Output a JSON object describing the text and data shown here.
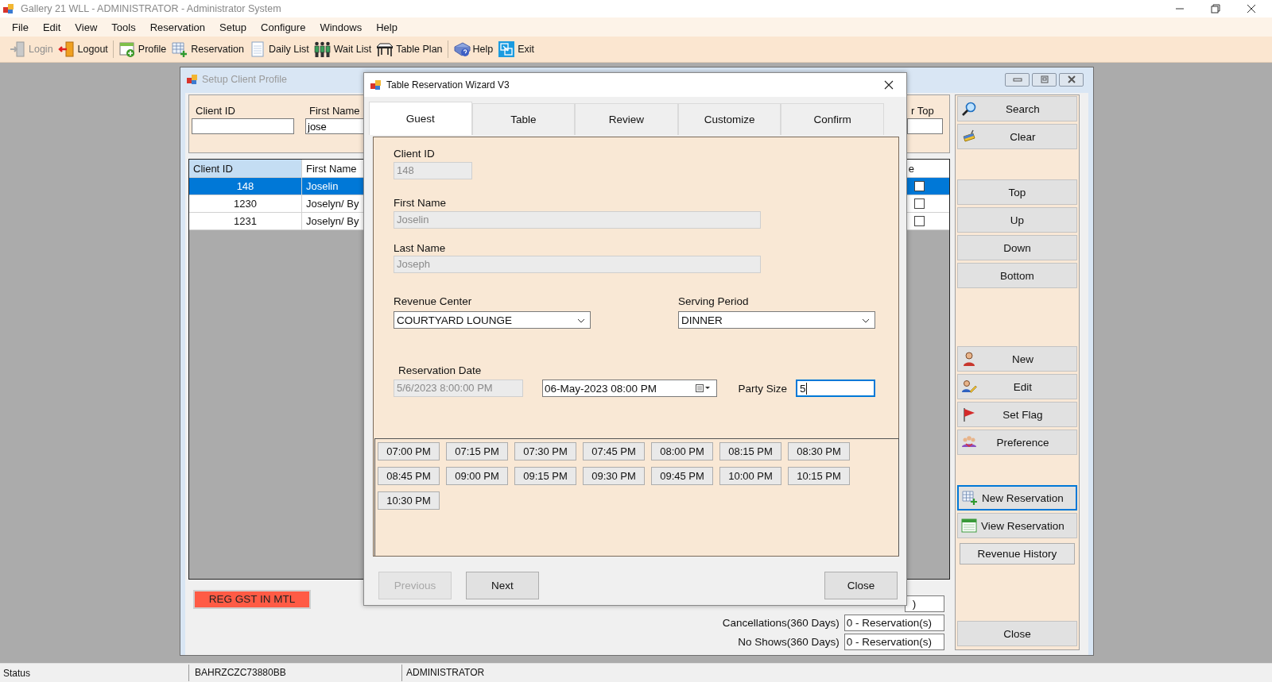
{
  "window": {
    "title": "Gallery 21 WLL  -  ADMINISTRATOR - Administrator System"
  },
  "menu": [
    "File",
    "Edit",
    "View",
    "Tools",
    "Reservation",
    "Setup",
    "Configure",
    "Windows",
    "Help"
  ],
  "toolbar": [
    {
      "items": [
        {
          "label": "Login",
          "disabled": true
        },
        {
          "label": "Logout",
          "disabled": false
        }
      ]
    },
    {
      "items": [
        {
          "label": "Profile",
          "disabled": false
        },
        {
          "label": "Reservation",
          "disabled": false
        },
        {
          "label": "Daily List",
          "disabled": false
        },
        {
          "label": "Wait List",
          "disabled": false
        },
        {
          "label": "Table Plan",
          "disabled": false
        }
      ]
    },
    {
      "items": [
        {
          "label": "Help",
          "disabled": false
        },
        {
          "label": "Exit",
          "disabled": false
        }
      ]
    }
  ],
  "client_profile": {
    "title": "Setup Client Profile",
    "search_fields": [
      {
        "label": "Client ID"
      },
      {
        "label": "First Name",
        "value": "jose"
      },
      {
        "label": "r Top"
      }
    ],
    "table": {
      "columns": [
        "Client ID",
        "First Name",
        "e"
      ],
      "rows": [
        {
          "client_id": "148",
          "first_name": "Joselin",
          "checked": false,
          "selected": true
        },
        {
          "client_id": "1230",
          "first_name": "Joselyn/ By",
          "checked": false,
          "selected": false
        },
        {
          "client_id": "1231",
          "first_name": "Joselyn/ By",
          "checked": false,
          "selected": false
        }
      ]
    },
    "flag": "REG GST IN MTL",
    "stats": [
      {
        "value": ")"
      },
      {
        "label": "Cancellations(360 Days)",
        "value": "0 - Reservation(s)"
      },
      {
        "label": "No Shows(360 Days)",
        "value": "0 - Reservation(s)"
      }
    ],
    "button_groups": [
      {
        "buttons": [
          {
            "label": "Search",
            "focused": false
          },
          {
            "label": "Clear",
            "focused": false
          }
        ]
      },
      {
        "buttons": [
          {
            "label": "Top",
            "focused": false
          },
          {
            "label": "Up",
            "focused": false
          },
          {
            "label": "Down",
            "focused": false
          },
          {
            "label": "Bottom",
            "focused": false
          }
        ]
      },
      {
        "buttons": [
          {
            "label": "New",
            "focused": false
          },
          {
            "label": "Edit",
            "focused": false
          },
          {
            "label": "Set Flag",
            "focused": false
          },
          {
            "label": "Preference",
            "focused": false
          }
        ]
      },
      {
        "buttons": [
          {
            "label": "New Reservation",
            "focused": true
          },
          {
            "label": "View Reservation",
            "focused": false
          },
          {
            "label": "Revenue History",
            "focused": false
          }
        ]
      },
      {
        "buttons": [
          {
            "label": "Close",
            "focused": false
          }
        ]
      }
    ]
  },
  "wizard": {
    "title": "Table Reservation Wizard V3",
    "tabs": [
      {
        "label": "Guest",
        "selected": true
      },
      {
        "label": "Table",
        "selected": false
      },
      {
        "label": "Review",
        "selected": false
      },
      {
        "label": "Customize",
        "selected": false
      },
      {
        "label": "Confirm",
        "selected": false
      }
    ],
    "client_id": {
      "label": "Client ID",
      "value": "148",
      "disabled": true
    },
    "first_name": {
      "label": "First Name",
      "value": "Joselin",
      "disabled": true
    },
    "last_name": {
      "label": "Last Name",
      "value": "Joseph",
      "disabled": true
    },
    "revenue_center": {
      "label": "Revenue Center",
      "value": "COURTYARD LOUNGE"
    },
    "serving_period": {
      "label": "Serving Period",
      "value": "DINNER"
    },
    "reservation_date": {
      "label": "Reservation Date",
      "value": "5/6/2023 8:00:00 PM",
      "disabled": true,
      "picker": "06-May-2023 08:00 PM"
    },
    "party_size": {
      "label": "Party Size",
      "value": "5",
      "focused": true
    },
    "time_slots": [
      "07:00 PM",
      "07:15 PM",
      "07:30 PM",
      "07:45 PM",
      "08:00 PM",
      "08:15 PM",
      "08:30 PM",
      "08:45 PM",
      "09:00 PM",
      "09:15 PM",
      "09:30 PM",
      "09:45 PM",
      "10:00 PM",
      "10:15 PM",
      "10:30 PM"
    ],
    "footer": [
      {
        "label": "Previous",
        "disabled": true
      },
      {
        "label": "Next",
        "disabled": false
      },
      {
        "label": "Close",
        "disabled": false
      }
    ]
  },
  "status_bar": [
    "Status",
    "BAHRZCZC73880BB",
    "ADMINISTRATOR"
  ]
}
